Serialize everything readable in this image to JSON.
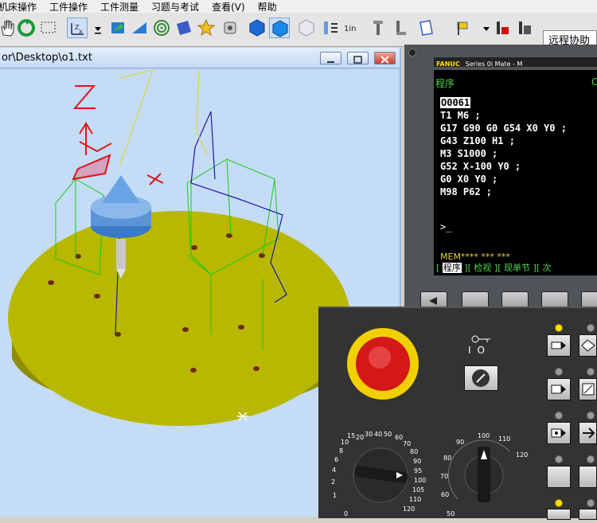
{
  "menu": [
    "机床操作",
    "工件操作",
    "工件测量",
    "习题与考试",
    "查看(V)",
    "帮助"
  ],
  "toolbar": {
    "combo_value": "远程协助",
    "icons": [
      "hand-icon",
      "refresh-icon",
      "select-box-icon",
      "zoom-axis-icon",
      "dropdown-icon",
      "view-iso-icon",
      "view-plane-icon",
      "spiral-icon",
      "book-icon",
      "star-icon",
      "wrench-icon",
      "cube-blue-icon",
      "cube-blue2-icon",
      "cube-white-icon",
      "arrows-icon",
      "inch-metric-icon",
      "tool-icon",
      "tool2-icon",
      "notebook-icon",
      "flag-icon",
      "record-icon",
      "save-icon"
    ]
  },
  "subwindow": {
    "title": "or\\Desktop\\o1.txt"
  },
  "cnc": {
    "brand": "FANUC",
    "model": "Series 0",
    "model_suffix": "i Mate - M",
    "screen_title": "程序",
    "screen_title_right": "O",
    "program_number": "O0061",
    "program_lines": [
      "T1 M6 ;",
      "G17 G90 G0 G54 X0 Y0 ;",
      "G43 Z100 H1 ;",
      "M3 S1000 ;",
      "G52 X-100 Y0 ;",
      "G0 X0 Y0 ;",
      "M98 P62 ;"
    ],
    "prompt": ">_",
    "status_line": "MEM**** ***    ***",
    "soft_keys": {
      "k1": "程序",
      "k2": "检视",
      "k3": "现单节",
      "k4": "次"
    }
  },
  "panel": {
    "feed_dial_labels": [
      "0",
      "1",
      "2",
      "4",
      "6",
      "8",
      "10",
      "15",
      "20",
      "30",
      "40",
      "50",
      "60",
      "70",
      "80",
      "90",
      "95",
      "100",
      "105",
      "110",
      "120"
    ],
    "spindle_dial_labels": [
      "50",
      "60",
      "70",
      "80",
      "90",
      "100",
      "110",
      "120"
    ],
    "key_switch_symbols": [
      "I",
      "O"
    ]
  },
  "colors": {
    "fanuc_yellow": "#ffe000",
    "crt_green": "#4fd84f",
    "table_yellow": "#b8b800",
    "estop_red": "#d41818"
  }
}
